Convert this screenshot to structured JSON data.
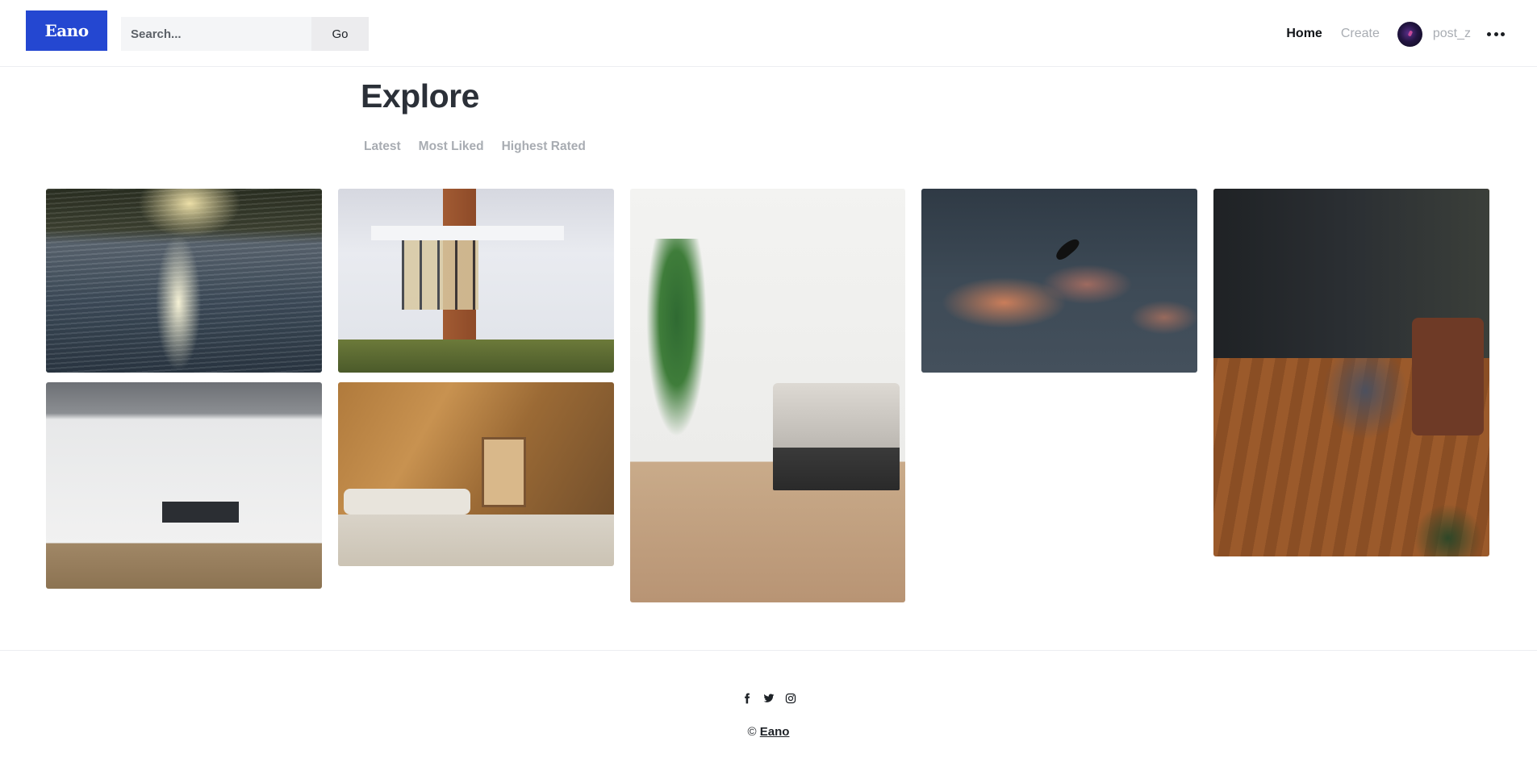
{
  "header": {
    "logo": "Eano",
    "search": {
      "placeholder": "Search...",
      "value": "",
      "button_label": "Go"
    },
    "nav": {
      "home": "Home",
      "create": "Create"
    },
    "user": {
      "username": "post_z"
    }
  },
  "main": {
    "title": "Explore",
    "tabs": [
      {
        "label": "Latest"
      },
      {
        "label": "Most Liked"
      },
      {
        "label": "Highest Rated"
      }
    ],
    "photos": [
      {
        "subject": "sunlit lake water"
      },
      {
        "subject": "modern white house"
      },
      {
        "subject": "potted plants and bed"
      },
      {
        "subject": "bird flying in cloudy sky"
      },
      {
        "subject": "living room top view"
      },
      {
        "subject": "grey dining room"
      },
      {
        "subject": "wooden cabin living room"
      }
    ]
  },
  "footer": {
    "social_icons": [
      "facebook-icon",
      "twitter-icon",
      "instagram-icon"
    ],
    "copyright_symbol": "©",
    "brand_link": "Eano"
  },
  "colors": {
    "brand": "#2447d1",
    "title": "#2b3038",
    "muted": "#a8acb2"
  }
}
